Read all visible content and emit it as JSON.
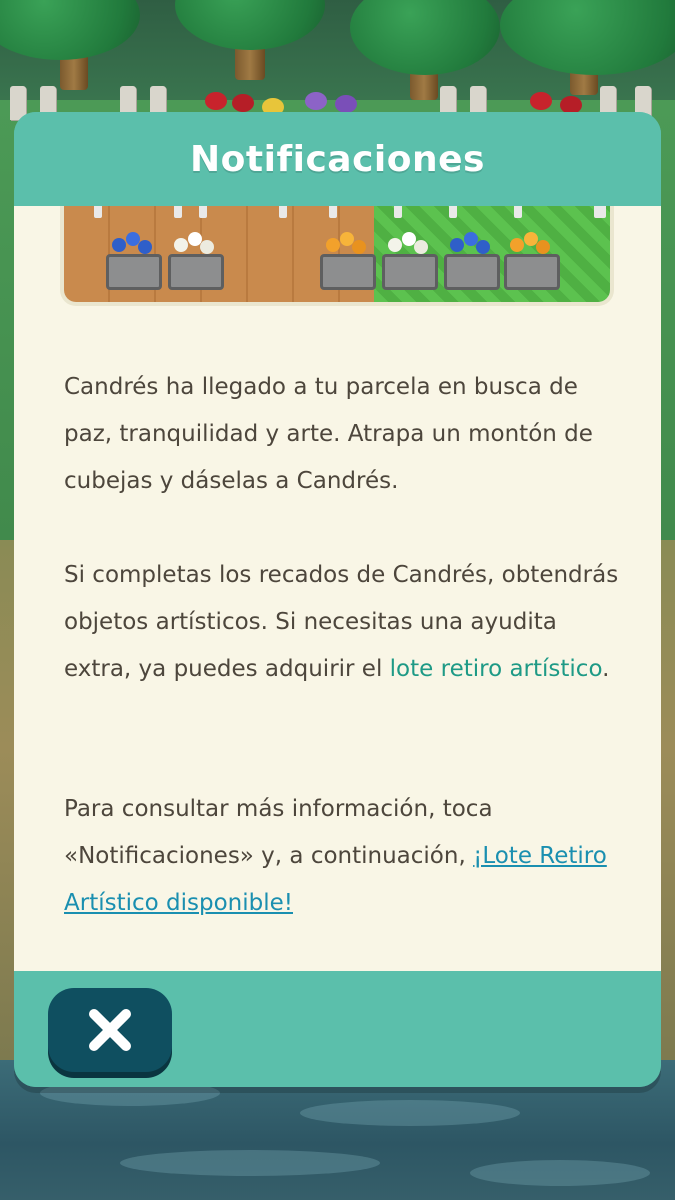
{
  "dialog": {
    "title": "Notificaciones",
    "paragraph1": "Candrés ha llegado a tu parcela en busca de paz, tranquilidad y arte. Atrapa un montón de cubejas y dáselas a Candrés.",
    "paragraph2_text": "Si completas los recados de Candrés, obtendrás objetos artísticos. Si necesitas una ayudita extra, ya puedes adquirir el ",
    "paragraph2_link": "lote retiro artístico",
    "paragraph2_end": ".",
    "paragraph3_text": "Para consultar más información, toca «Notificaciones» y, a continuación, ",
    "paragraph3_link": "¡Lote Retiro Artístico disponible!",
    "close_icon": "close-icon"
  },
  "colors": {
    "header": "#5bbfab",
    "body": "#f9f6e6",
    "text": "#4d463c",
    "link": "#1e9a86",
    "link_underlined": "#1a8fb0",
    "close_button": "#0f4f60"
  }
}
